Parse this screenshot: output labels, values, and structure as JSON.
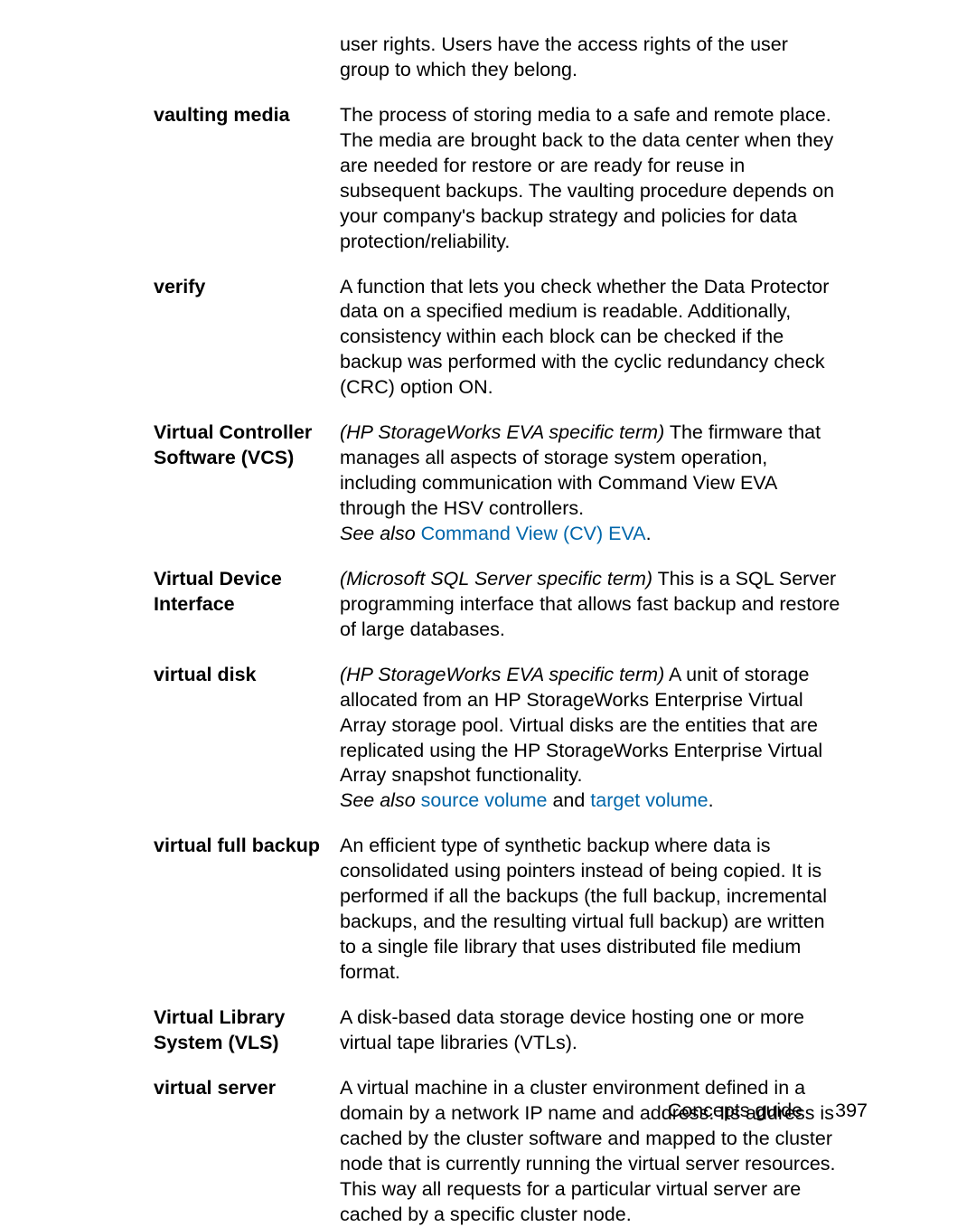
{
  "continuation": {
    "text": "user rights. Users have the access rights of the user group to which they belong."
  },
  "entries": [
    {
      "term": "vaulting media",
      "def": "The process of storing media to a safe and remote place. The media are brought back to the data center when they are needed for restore or are ready for reuse in subsequent backups. The vaulting procedure depends on your company's backup strategy and policies for data protection/reliability."
    },
    {
      "term": "verify",
      "def": "A function that lets you check whether the Data Protector data on a specified medium is readable. Additionally, consistency within each block can be checked if the backup was performed with the cyclic redundancy check (CRC) option ON."
    },
    {
      "term": "Virtual Controller Software (VCS)",
      "def_prefix_italic": "(HP StorageWorks EVA specific term)",
      "def_body": " The firmware that manages all aspects of storage system operation, including communication with Command View EVA through the HSV controllers.",
      "see_also_label": "See also",
      "see_also_link": " Command View (CV) EVA",
      "see_also_suffix": "."
    },
    {
      "term": "Virtual Device Interface",
      "def_prefix_italic": "(Microsoft SQL Server specific term)",
      "def_body": " This is a SQL Server programming interface that allows fast backup and restore of large databases."
    },
    {
      "term": "virtual disk",
      "def_prefix_italic": "(HP StorageWorks EVA specific term)",
      "def_body": " A unit of storage allocated from an HP StorageWorks Enterprise Virtual Array storage pool. Virtual disks are the entities that are replicated using the HP StorageWorks Enterprise Virtual Array snapshot functionality.",
      "see_also_label": "See also",
      "see_also_link": " source volume",
      "see_also_mid": " and",
      "see_also_link2": " target volume",
      "see_also_suffix": "."
    },
    {
      "term": "virtual full backup",
      "def": "An efficient type of synthetic backup where data is consolidated using pointers instead of being copied. It is performed if all the backups (the full backup, incremental backups, and the resulting virtual full backup) are written to a single file library that uses distributed file medium format."
    },
    {
      "term": "Virtual Library System (VLS)",
      "def": "A disk-based data storage device hosting one or more virtual tape libraries (VTLs)."
    },
    {
      "term": "virtual server",
      "def": "A virtual machine in a cluster environment defined in a domain by a network IP name and address. Its address is cached by the cluster software and mapped to the cluster node that is currently running the virtual server resources. This way all requests for a particular virtual server are cached by a specific cluster node."
    }
  ],
  "footer": {
    "title": "Concepts guide",
    "page": "397"
  }
}
